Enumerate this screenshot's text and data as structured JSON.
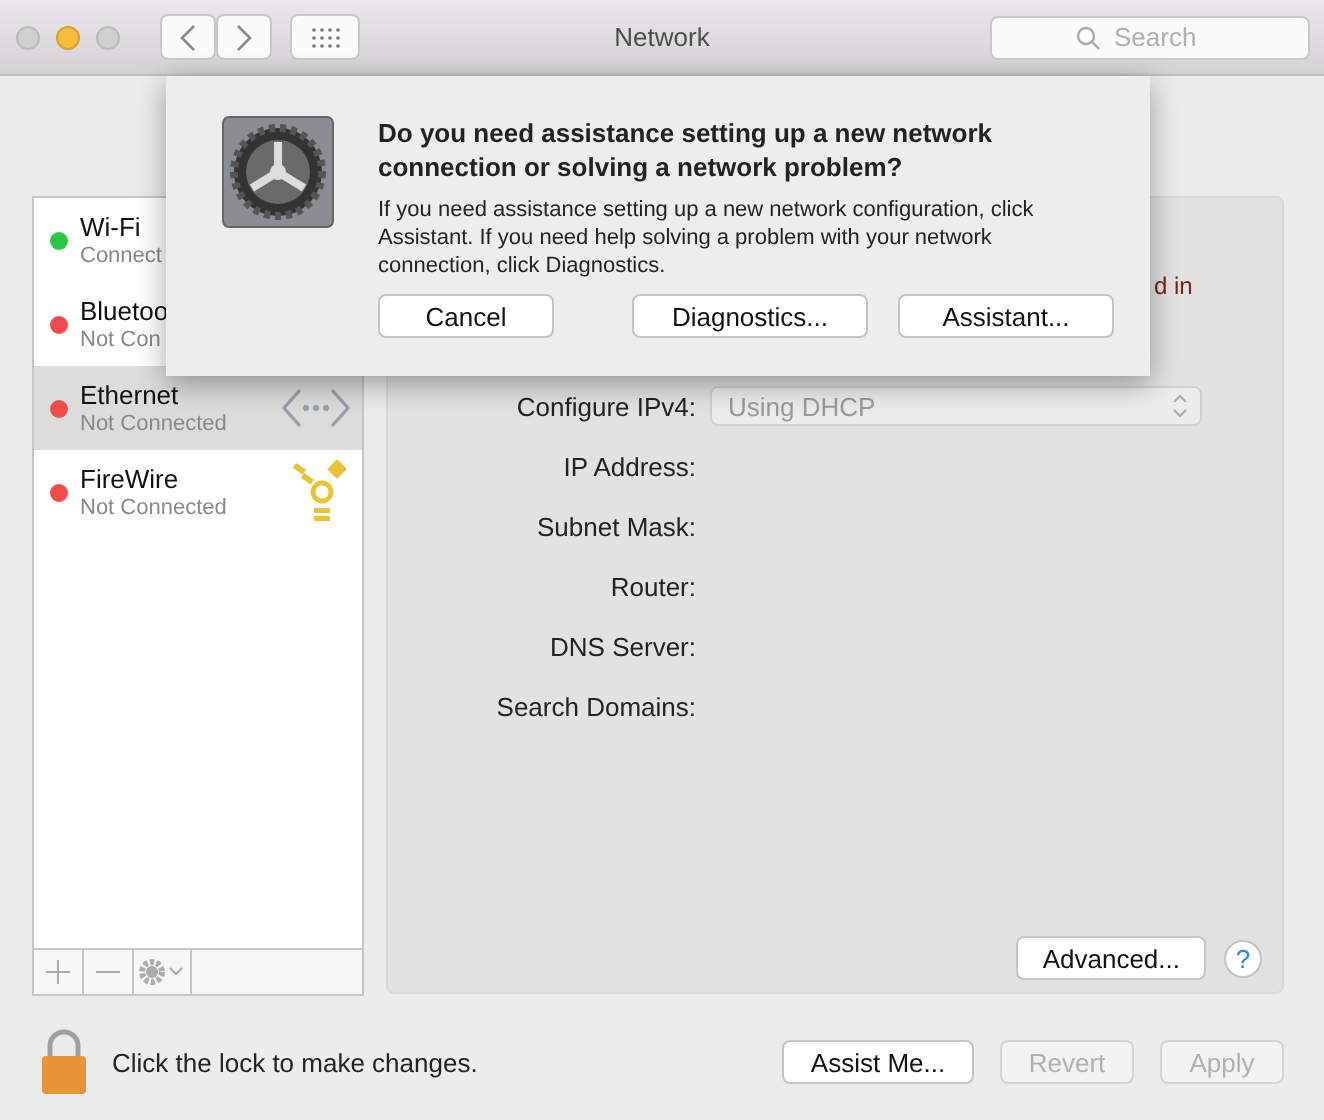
{
  "window": {
    "title": "Network"
  },
  "search": {
    "placeholder": "Search"
  },
  "services": [
    {
      "name": "Wi-Fi",
      "status": "Connect",
      "color": "#28c940",
      "selected": false,
      "kind": "wifi"
    },
    {
      "name": "Bluetoo",
      "status": "Not Con",
      "color": "#f24b4b",
      "selected": false,
      "kind": "bluetooth"
    },
    {
      "name": "Ethernet",
      "status": "Not Connected",
      "color": "#f24b4b",
      "selected": true,
      "kind": "ethernet"
    },
    {
      "name": "FireWire",
      "status": "Not Connected",
      "color": "#f24b4b",
      "selected": false,
      "kind": "firewire"
    }
  ],
  "detail": {
    "status_fragment": "d in",
    "fields": [
      {
        "label": "Configure IPv4:",
        "kind": "select",
        "value": "Using DHCP"
      },
      {
        "label": "IP Address:",
        "kind": "text"
      },
      {
        "label": "Subnet Mask:",
        "kind": "text"
      },
      {
        "label": "Router:",
        "kind": "text"
      },
      {
        "label": "DNS Server:",
        "kind": "text"
      },
      {
        "label": "Search Domains:",
        "kind": "text"
      }
    ],
    "advanced_button": "Advanced...",
    "help_button": "?"
  },
  "dialog": {
    "title": "Do you need assistance setting up a new network connection or solving a network problem?",
    "message": "If you need assistance setting up a new network configuration, click Assistant. If you need help solving a problem with your network connection, click Diagnostics.",
    "buttons": [
      "Cancel",
      "Diagnostics...",
      "Assistant..."
    ]
  },
  "footer": {
    "lock_text": "Click the lock to make changes.",
    "buttons": [
      {
        "label": "Assist Me...",
        "disabled": false
      },
      {
        "label": "Revert",
        "disabled": true
      },
      {
        "label": "Apply",
        "disabled": true
      }
    ]
  }
}
